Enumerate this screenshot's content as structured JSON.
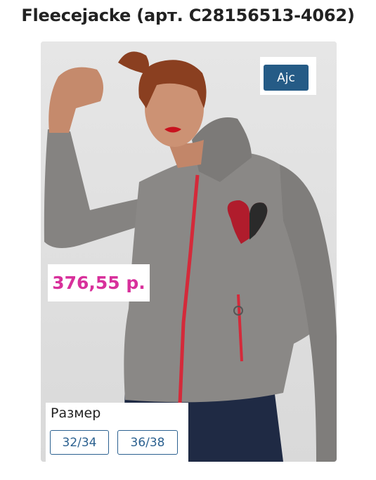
{
  "product": {
    "title": "Fleecejacke (арт. C28156513-4062)",
    "brand_label": "Ajc",
    "price": "376,55 р.",
    "photo_alt": "Fleecejacke"
  },
  "sizes": {
    "label": "Размер",
    "options": [
      "32/34",
      "36/38"
    ]
  },
  "colors": {
    "price": "#d8309b",
    "brand_button": "#255b86",
    "size_button_border": "#2c6190",
    "jacket": "#8a8886",
    "zipper": "#d42a3a"
  }
}
